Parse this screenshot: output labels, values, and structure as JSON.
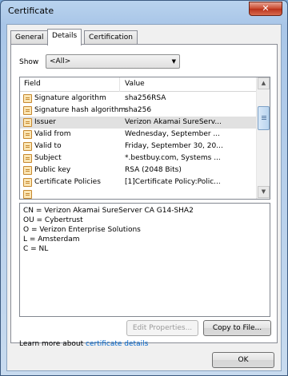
{
  "window": {
    "title": "Certificate",
    "close_label": "✕"
  },
  "tabs": [
    {
      "label": "General"
    },
    {
      "label": "Details"
    },
    {
      "label": "Certification Path"
    }
  ],
  "show": {
    "label": "Show",
    "selected": "<All>"
  },
  "table": {
    "headers": {
      "field": "Field",
      "value": "Value"
    },
    "rows": [
      {
        "field": "Signature algorithm",
        "value": "sha256RSA"
      },
      {
        "field": "Signature hash algorithm",
        "value": "sha256"
      },
      {
        "field": "Issuer",
        "value": "Verizon Akamai SureServ..."
      },
      {
        "field": "Valid from",
        "value": "Wednesday, September ..."
      },
      {
        "field": "Valid to",
        "value": "Friday, September 30, 20..."
      },
      {
        "field": "Subject",
        "value": "*.bestbuy.com, Systems ..."
      },
      {
        "field": "Public key",
        "value": "RSA (2048 Bits)"
      },
      {
        "field": "Certificate Policies",
        "value": "[1]Certificate Policy:Polic..."
      }
    ]
  },
  "details_lines": [
    "CN = Verizon Akamai SureServer CA G14-SHA2",
    "OU = Cybertrust",
    "O = Verizon Enterprise Solutions",
    "L = Amsterdam",
    "C = NL"
  ],
  "buttons": {
    "edit_properties": "Edit Properties...",
    "copy_to_file": "Copy to File...",
    "ok": "OK"
  },
  "learn_more": {
    "prefix": "Learn more about ",
    "link": "certificate details"
  }
}
